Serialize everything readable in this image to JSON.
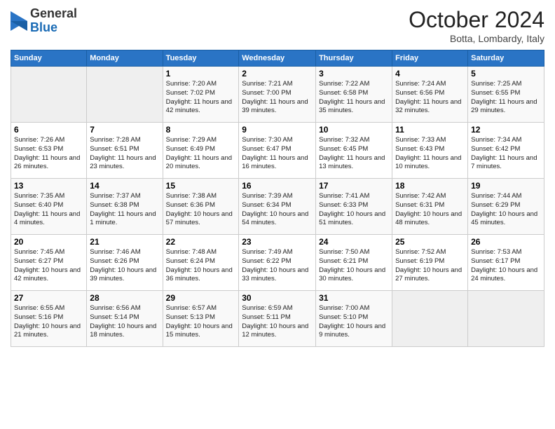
{
  "header": {
    "logo_general": "General",
    "logo_blue": "Blue",
    "month_title": "October 2024",
    "location": "Botta, Lombardy, Italy"
  },
  "calendar": {
    "days_of_week": [
      "Sunday",
      "Monday",
      "Tuesday",
      "Wednesday",
      "Thursday",
      "Friday",
      "Saturday"
    ],
    "weeks": [
      [
        {
          "day": "",
          "info": ""
        },
        {
          "day": "",
          "info": ""
        },
        {
          "day": "1",
          "info": "Sunrise: 7:20 AM\nSunset: 7:02 PM\nDaylight: 11 hours and 42 minutes."
        },
        {
          "day": "2",
          "info": "Sunrise: 7:21 AM\nSunset: 7:00 PM\nDaylight: 11 hours and 39 minutes."
        },
        {
          "day": "3",
          "info": "Sunrise: 7:22 AM\nSunset: 6:58 PM\nDaylight: 11 hours and 35 minutes."
        },
        {
          "day": "4",
          "info": "Sunrise: 7:24 AM\nSunset: 6:56 PM\nDaylight: 11 hours and 32 minutes."
        },
        {
          "day": "5",
          "info": "Sunrise: 7:25 AM\nSunset: 6:55 PM\nDaylight: 11 hours and 29 minutes."
        }
      ],
      [
        {
          "day": "6",
          "info": "Sunrise: 7:26 AM\nSunset: 6:53 PM\nDaylight: 11 hours and 26 minutes."
        },
        {
          "day": "7",
          "info": "Sunrise: 7:28 AM\nSunset: 6:51 PM\nDaylight: 11 hours and 23 minutes."
        },
        {
          "day": "8",
          "info": "Sunrise: 7:29 AM\nSunset: 6:49 PM\nDaylight: 11 hours and 20 minutes."
        },
        {
          "day": "9",
          "info": "Sunrise: 7:30 AM\nSunset: 6:47 PM\nDaylight: 11 hours and 16 minutes."
        },
        {
          "day": "10",
          "info": "Sunrise: 7:32 AM\nSunset: 6:45 PM\nDaylight: 11 hours and 13 minutes."
        },
        {
          "day": "11",
          "info": "Sunrise: 7:33 AM\nSunset: 6:43 PM\nDaylight: 11 hours and 10 minutes."
        },
        {
          "day": "12",
          "info": "Sunrise: 7:34 AM\nSunset: 6:42 PM\nDaylight: 11 hours and 7 minutes."
        }
      ],
      [
        {
          "day": "13",
          "info": "Sunrise: 7:35 AM\nSunset: 6:40 PM\nDaylight: 11 hours and 4 minutes."
        },
        {
          "day": "14",
          "info": "Sunrise: 7:37 AM\nSunset: 6:38 PM\nDaylight: 11 hours and 1 minute."
        },
        {
          "day": "15",
          "info": "Sunrise: 7:38 AM\nSunset: 6:36 PM\nDaylight: 10 hours and 57 minutes."
        },
        {
          "day": "16",
          "info": "Sunrise: 7:39 AM\nSunset: 6:34 PM\nDaylight: 10 hours and 54 minutes."
        },
        {
          "day": "17",
          "info": "Sunrise: 7:41 AM\nSunset: 6:33 PM\nDaylight: 10 hours and 51 minutes."
        },
        {
          "day": "18",
          "info": "Sunrise: 7:42 AM\nSunset: 6:31 PM\nDaylight: 10 hours and 48 minutes."
        },
        {
          "day": "19",
          "info": "Sunrise: 7:44 AM\nSunset: 6:29 PM\nDaylight: 10 hours and 45 minutes."
        }
      ],
      [
        {
          "day": "20",
          "info": "Sunrise: 7:45 AM\nSunset: 6:27 PM\nDaylight: 10 hours and 42 minutes."
        },
        {
          "day": "21",
          "info": "Sunrise: 7:46 AM\nSunset: 6:26 PM\nDaylight: 10 hours and 39 minutes."
        },
        {
          "day": "22",
          "info": "Sunrise: 7:48 AM\nSunset: 6:24 PM\nDaylight: 10 hours and 36 minutes."
        },
        {
          "day": "23",
          "info": "Sunrise: 7:49 AM\nSunset: 6:22 PM\nDaylight: 10 hours and 33 minutes."
        },
        {
          "day": "24",
          "info": "Sunrise: 7:50 AM\nSunset: 6:21 PM\nDaylight: 10 hours and 30 minutes."
        },
        {
          "day": "25",
          "info": "Sunrise: 7:52 AM\nSunset: 6:19 PM\nDaylight: 10 hours and 27 minutes."
        },
        {
          "day": "26",
          "info": "Sunrise: 7:53 AM\nSunset: 6:17 PM\nDaylight: 10 hours and 24 minutes."
        }
      ],
      [
        {
          "day": "27",
          "info": "Sunrise: 6:55 AM\nSunset: 5:16 PM\nDaylight: 10 hours and 21 minutes."
        },
        {
          "day": "28",
          "info": "Sunrise: 6:56 AM\nSunset: 5:14 PM\nDaylight: 10 hours and 18 minutes."
        },
        {
          "day": "29",
          "info": "Sunrise: 6:57 AM\nSunset: 5:13 PM\nDaylight: 10 hours and 15 minutes."
        },
        {
          "day": "30",
          "info": "Sunrise: 6:59 AM\nSunset: 5:11 PM\nDaylight: 10 hours and 12 minutes."
        },
        {
          "day": "31",
          "info": "Sunrise: 7:00 AM\nSunset: 5:10 PM\nDaylight: 10 hours and 9 minutes."
        },
        {
          "day": "",
          "info": ""
        },
        {
          "day": "",
          "info": ""
        }
      ]
    ]
  }
}
